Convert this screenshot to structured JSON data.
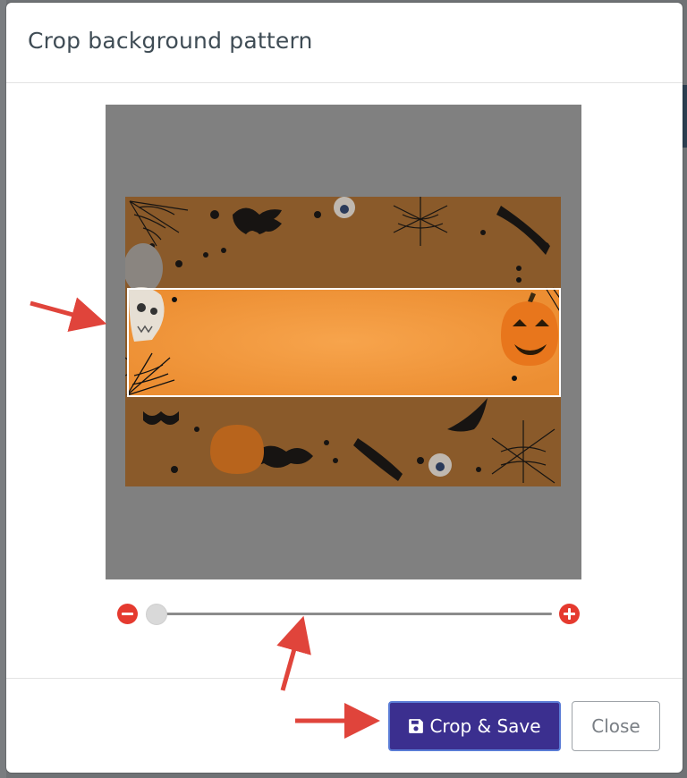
{
  "modal": {
    "title": "Crop background pattern"
  },
  "crop": {
    "image_subject": "halloween-orange-background",
    "accent_colors": {
      "orange": "#f29a3e",
      "dark_overlay": "#808080",
      "selection_border": "#ffffff"
    }
  },
  "zoom": {
    "min_icon": "minus-circle-icon",
    "max_icon": "plus-circle-icon",
    "level": 0
  },
  "footer": {
    "crop_save_label": "Crop & Save",
    "close_label": "Close",
    "save_icon": "floppy-disk-icon"
  },
  "colors": {
    "primary_button": "#3b2f8f",
    "zoom_icon": "#e53a2f",
    "annotation_arrow": "#e0443b"
  }
}
